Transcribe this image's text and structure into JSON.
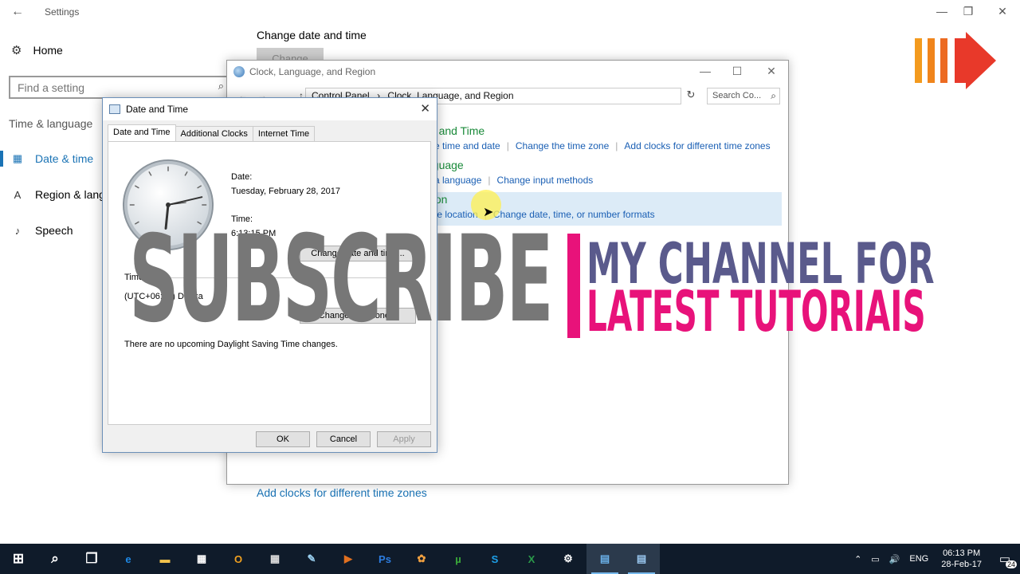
{
  "settings": {
    "title": "Settings",
    "back_glyph": "←",
    "window_controls": [
      "—",
      "❐",
      "✕"
    ],
    "home_label": "Home",
    "search_placeholder": "Find a setting",
    "section_label": "Time & language",
    "nav": [
      {
        "label": "Date & time",
        "icon": "calendar-clock-icon",
        "active": true
      },
      {
        "label": "Region & lang",
        "icon": "region-language-icon",
        "active": false
      },
      {
        "label": "Speech",
        "icon": "microphone-icon",
        "active": false
      }
    ],
    "page_heading": "Change date and time",
    "change_button": "Change",
    "bottom_link": "Add clocks for different time zones"
  },
  "control_panel": {
    "title": "Clock, Language, and Region",
    "window_controls": [
      "—",
      "☐",
      "✕"
    ],
    "nav_glyphs": [
      "←",
      "→",
      "↑"
    ],
    "breadcrumbs": [
      "Control Panel",
      "›",
      "Clock, Language, and Region"
    ],
    "search_placeholder": "Search Co...",
    "categories": [
      {
        "title": "te and Time",
        "links": [
          "the time and date",
          "Change the time zone",
          "Add clocks for different time zones"
        ]
      },
      {
        "title": "nguage",
        "links": [
          "d a language",
          "Change input methods"
        ]
      },
      {
        "title": "gion",
        "links": [
          "nge location",
          "Change date, time, or number formats"
        ]
      }
    ]
  },
  "date_time_dialog": {
    "title": "Date and Time",
    "tabs": [
      "Date and Time",
      "Additional Clocks",
      "Internet Time"
    ],
    "date_label": "Date:",
    "date_value": "Tuesday, February 28, 2017",
    "time_label": "Time:",
    "time_value": "6:13:15 PM",
    "change_dt_button": "Change date and time...",
    "timezone_label": "Time zone",
    "timezone_value": "(UTC+06:00) Dhaka",
    "change_tz_button": "Change time zone...",
    "dst_note": "There are no upcoming Daylight Saving Time changes.",
    "ok": "OK",
    "cancel": "Cancel",
    "apply": "Apply"
  },
  "overlay": {
    "subscribe": "SUBSCRIBE",
    "line1": "MY CHANNEL FOR",
    "line2": "LATEST TUTORIAIS",
    "accent_color": "#e8127a",
    "logo_color": "#f28a1a",
    "arrow_color": "#e8392a"
  },
  "taskbar": {
    "apps": [
      {
        "name": "start-icon",
        "glyph": "⊞",
        "color": "#ffffff"
      },
      {
        "name": "search-icon",
        "glyph": "⌕",
        "color": "#ffffff"
      },
      {
        "name": "task-view-icon",
        "glyph": "❐",
        "color": "#ffffff"
      },
      {
        "name": "edge-icon",
        "glyph": "e",
        "color": "#1e88e5"
      },
      {
        "name": "file-explorer-icon",
        "glyph": "▬",
        "color": "#f2c24c"
      },
      {
        "name": "store-icon",
        "glyph": "▦",
        "color": "#ffffff"
      },
      {
        "name": "outlook-icon",
        "glyph": "O",
        "color": "#f0a020"
      },
      {
        "name": "calculator-icon",
        "glyph": "▦",
        "color": "#dddddd"
      },
      {
        "name": "paint-icon",
        "glyph": "✎",
        "color": "#9ad0f0"
      },
      {
        "name": "media-player-icon",
        "glyph": "▶",
        "color": "#e07020"
      },
      {
        "name": "photoshop-icon",
        "glyph": "Ps",
        "color": "#2d7de0"
      },
      {
        "name": "chrome-icon",
        "glyph": "✿",
        "color": "#f0a040"
      },
      {
        "name": "utorrent-icon",
        "glyph": "µ",
        "color": "#3aaa3a"
      },
      {
        "name": "skype-icon",
        "glyph": "S",
        "color": "#1ea0e8"
      },
      {
        "name": "excel-icon",
        "glyph": "X",
        "color": "#2a9a4a"
      },
      {
        "name": "settings-icon",
        "glyph": "⚙",
        "color": "#ffffff"
      },
      {
        "name": "control-panel-icon",
        "glyph": "▤",
        "color": "#6ab0e8"
      },
      {
        "name": "date-time-icon",
        "glyph": "▤",
        "color": "#9ac8f0"
      }
    ],
    "tray_up": "⌃",
    "tray_network": "▭",
    "tray_volume": "🔊",
    "tray_lang": "ENG",
    "tray_time": "06:13 PM",
    "tray_date": "28-Feb-17",
    "notification_count": "24"
  }
}
